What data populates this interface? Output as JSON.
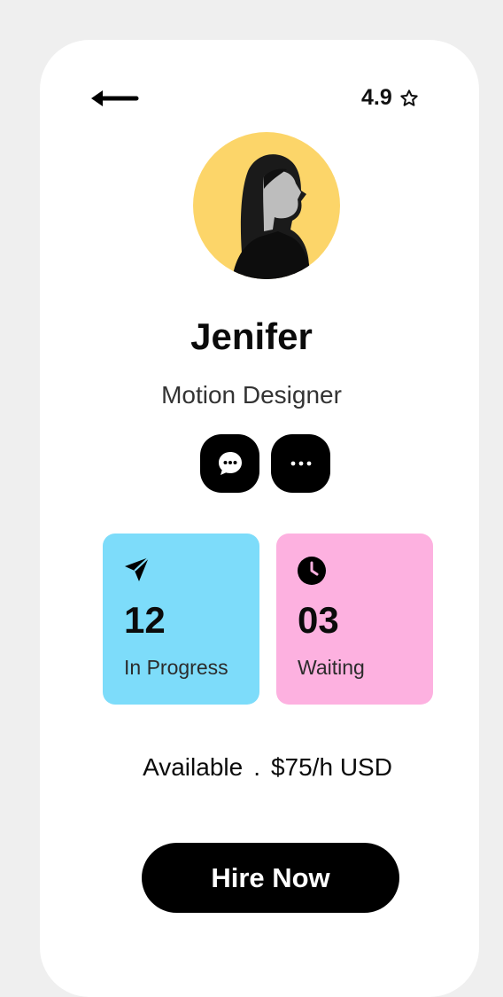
{
  "header": {
    "back_icon": "arrow-left-icon",
    "rating_value": "4.9",
    "rating_icon": "star-outline-icon"
  },
  "profile": {
    "name": "Jenifer",
    "role": "Motion Designer",
    "avatar_bg": "#fcd569"
  },
  "actions": {
    "chat_icon": "chat-bubble-icon",
    "more_icon": "more-dots-icon"
  },
  "stats": [
    {
      "value": "12",
      "label": "In Progress",
      "icon": "send-icon",
      "color": "#7ddcfa"
    },
    {
      "value": "03",
      "label": "Waiting",
      "icon": "clock-icon",
      "color": "#fdb1e0"
    }
  ],
  "availability": {
    "status": "Available",
    "separator": ".",
    "rate": "$75/h USD"
  },
  "cta": {
    "label": "Hire Now"
  }
}
